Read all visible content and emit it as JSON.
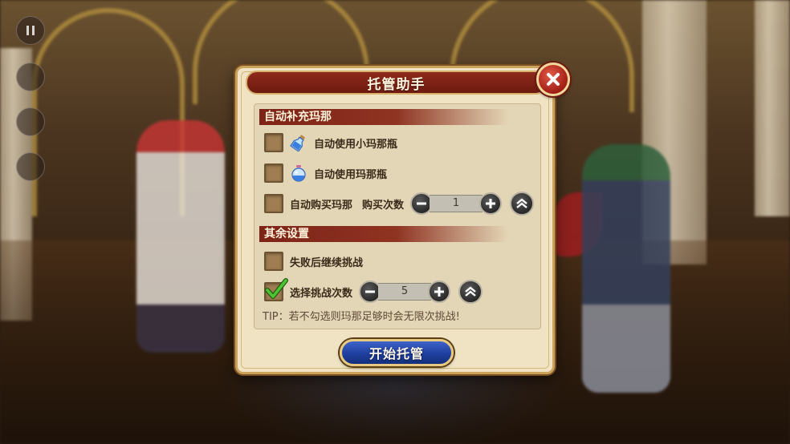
{
  "dialog": {
    "title": "托管助手",
    "close_icon": "close-icon"
  },
  "sections": {
    "mana": {
      "heading": "自动补充玛那",
      "rows": [
        {
          "label": "自动使用小玛那瓶",
          "checked": false,
          "icon": "small-mana-potion-icon"
        },
        {
          "label": "自动使用玛那瓶",
          "checked": false,
          "icon": "mana-potion-icon"
        },
        {
          "label": "自动购买玛那",
          "checked": false,
          "sub_label": "购买次数",
          "count": "1"
        }
      ]
    },
    "other": {
      "heading": "其余设置",
      "rows": [
        {
          "label": "失败后继续挑战",
          "checked": false
        },
        {
          "label": "选择挑战次数",
          "checked": true,
          "count": "5"
        }
      ]
    }
  },
  "tip": "TIP：若不勾选则玛那足够时会无限次挑战!",
  "start_button": {
    "label": "开始托管"
  },
  "colors": {
    "title_bar": "#8e2a1c",
    "panel": "#efe3c4",
    "start_button": "#1e3f9e",
    "check": "#3fae2a"
  }
}
